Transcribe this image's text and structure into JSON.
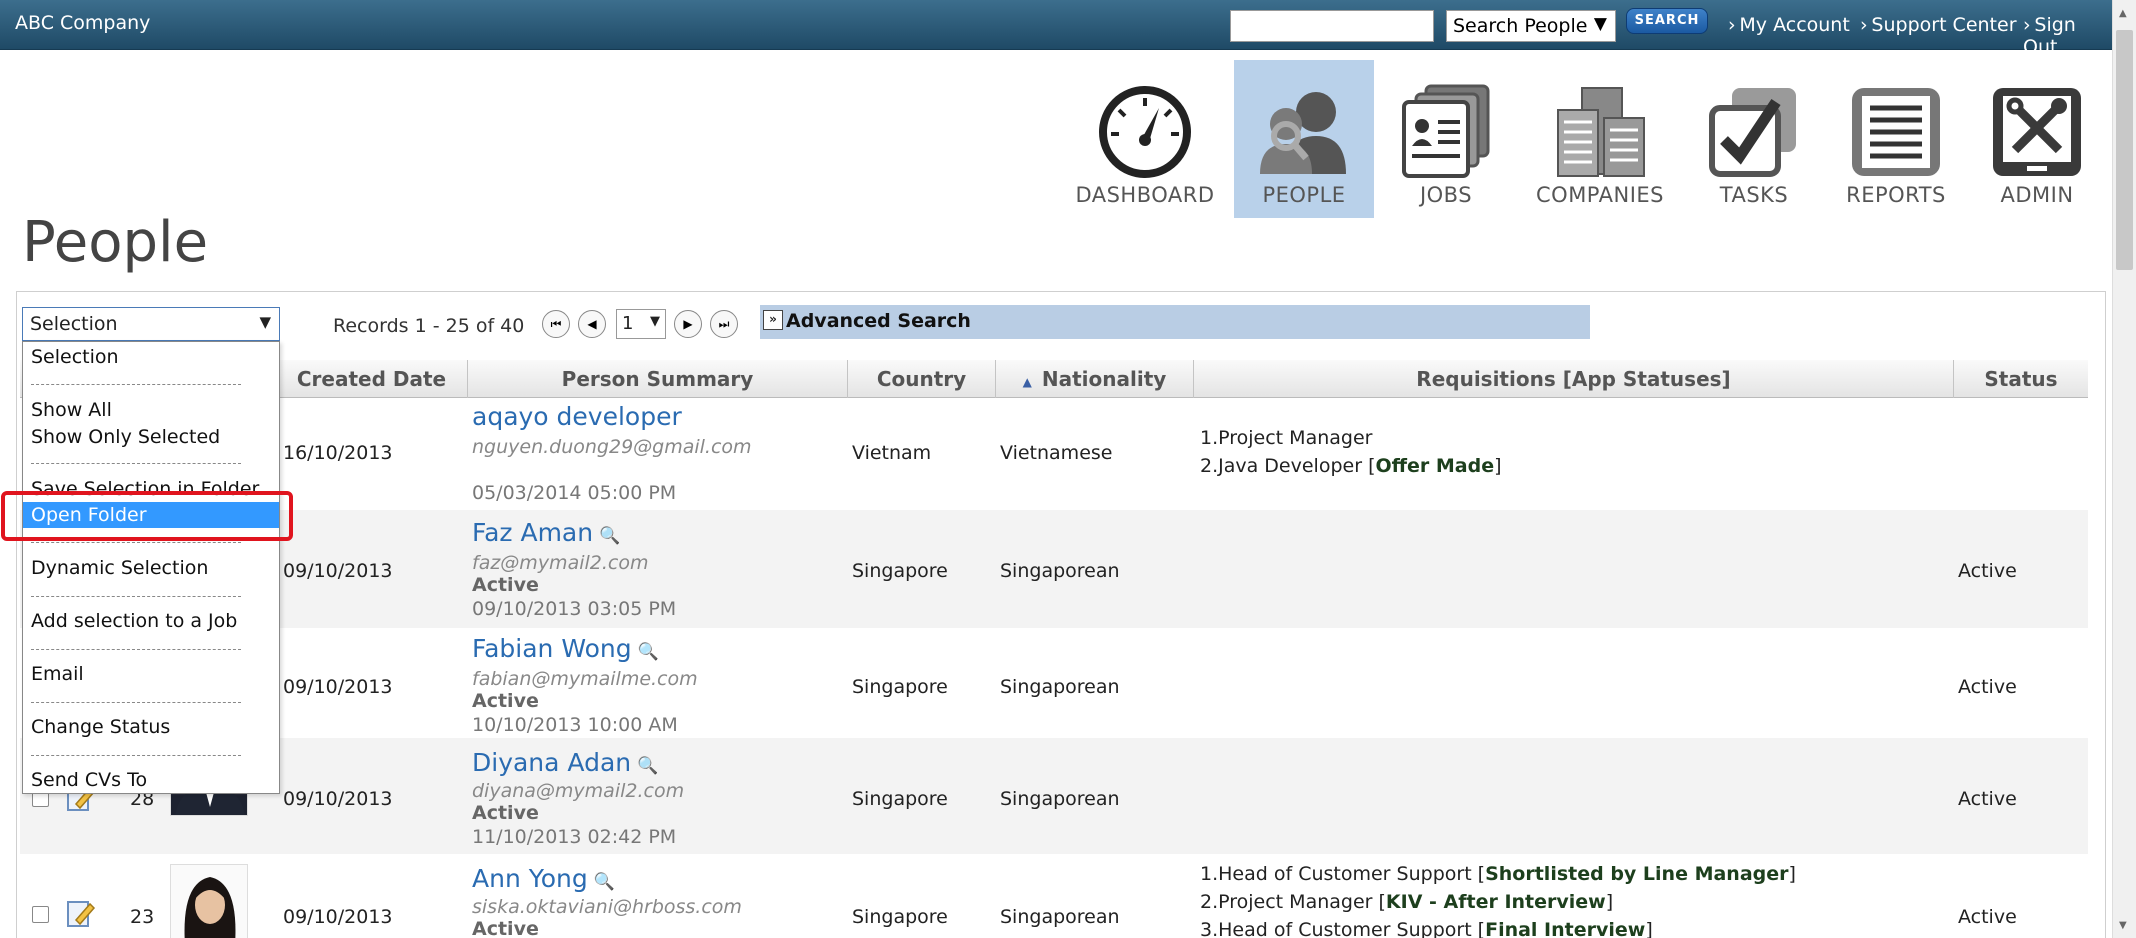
{
  "app": {
    "company": "ABC Company",
    "search_select": "Search People",
    "search_button": "SEARCH",
    "links": [
      "My Account",
      "Support Center",
      "Sign Out"
    ]
  },
  "nav": [
    {
      "label": "DASHBOARD",
      "icon": "dashboard-gauge-icon",
      "active": false
    },
    {
      "label": "PEOPLE",
      "icon": "people-icon",
      "active": true
    },
    {
      "label": "JOBS",
      "icon": "jobs-cards-icon",
      "active": false
    },
    {
      "label": "COMPANIES",
      "icon": "companies-buildings-icon",
      "active": false
    },
    {
      "label": "TASKS",
      "icon": "tasks-checkbox-icon",
      "active": false
    },
    {
      "label": "REPORTS",
      "icon": "reports-document-icon",
      "active": false
    },
    {
      "label": "ADMIN",
      "icon": "admin-tools-icon",
      "active": false
    }
  ],
  "page_title": "People",
  "toolbar": {
    "selection_value": "Selection",
    "records": "Records 1 - 25 of 40",
    "page": "1",
    "advanced_search": "Advanced Search"
  },
  "dropdown": {
    "options": [
      "Selection",
      "Show All",
      "Show Only Selected",
      "Save Selection in Folder",
      "Open Folder",
      "Dynamic Selection",
      "Add selection to a Job",
      "Email",
      "Change Status",
      "Send CVs To"
    ],
    "highlighted": "Open Folder"
  },
  "table": {
    "columns": [
      "Created Date",
      "Person Summary",
      "Country",
      "Nationality",
      "Requisitions [App Statuses]",
      "Status"
    ],
    "rows": [
      {
        "id": "",
        "created": "16/10/2013",
        "name": "aqayo developer",
        "email": "nguyen.duong29@gmail.com",
        "active": "",
        "datetime": "05/03/2014 05:00 PM",
        "country": "Vietnam",
        "nationality": "Vietnamese",
        "requisitions": [
          {
            "text": "1.Project Manager",
            "status": ""
          },
          {
            "text": "2.Java Developer",
            "status": "Offer Made"
          }
        ],
        "status": ""
      },
      {
        "id": "",
        "created": "09/10/2013",
        "name": "Faz Aman",
        "email": "faz@mymail2.com",
        "active": "Active",
        "datetime": "09/10/2013 03:05 PM",
        "country": "Singapore",
        "nationality": "Singaporean",
        "requisitions": [],
        "status": "Active"
      },
      {
        "id": "",
        "created": "09/10/2013",
        "name": "Fabian Wong",
        "email": "fabian@mymailme.com",
        "active": "Active",
        "datetime": "10/10/2013 10:00 AM",
        "country": "Singapore",
        "nationality": "Singaporean",
        "requisitions": [],
        "status": "Active"
      },
      {
        "id": "28",
        "created": "09/10/2013",
        "name": "Diyana Adan",
        "email": "diyana@mymail2.com",
        "active": "Active",
        "datetime": "11/10/2013 02:42 PM",
        "country": "Singapore",
        "nationality": "Singaporean",
        "requisitions": [],
        "status": "Active"
      },
      {
        "id": "23",
        "created": "09/10/2013",
        "name": "Ann Yong",
        "email": "siska.oktaviani@hrboss.com",
        "active": "Active",
        "datetime": "",
        "country": "Singapore",
        "nationality": "Singaporean",
        "requisitions": [
          {
            "text": "1.Head of Customer Support",
            "status": "Shortlisted by Line Manager"
          },
          {
            "text": "2.Project Manager",
            "status": "KIV - After Interview"
          },
          {
            "text": "3.Head of Customer Support",
            "status": "Final Interview"
          }
        ],
        "status": "Active"
      }
    ]
  },
  "colors": {
    "topbar": "#2b5a79",
    "active_nav": "#b9d1ea",
    "link": "#2a6bb1",
    "highlight": "#3399ff",
    "callout": "#e0141e"
  }
}
